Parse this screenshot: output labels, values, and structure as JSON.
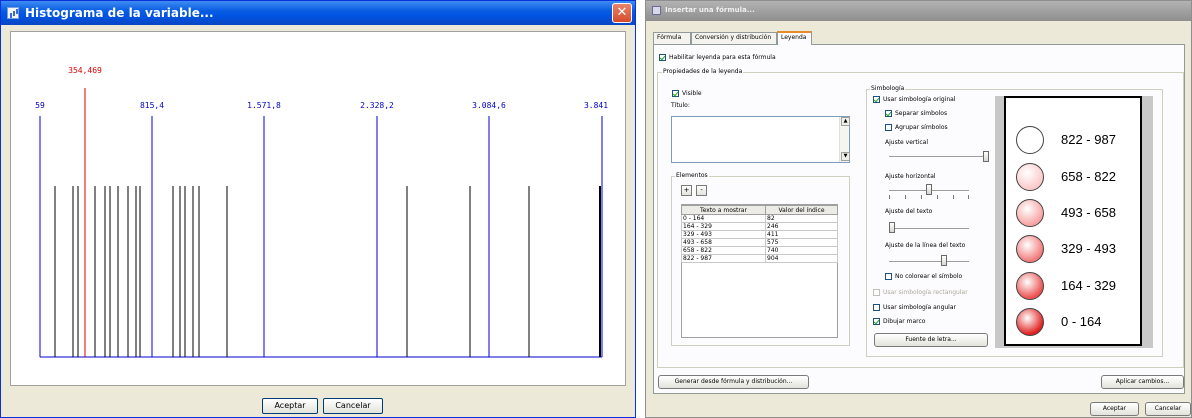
{
  "histogram_window": {
    "title": "Histograma de la variable...",
    "axis_labels": [
      "59",
      "815,4",
      "1.571,8",
      "2.328,2",
      "3.084,6",
      "3.841"
    ],
    "mean_label": "354,469",
    "data_bar_count": 19,
    "ok_button": "Aceptar",
    "cancel_button": "Cancelar",
    "colors": {
      "axis": "#0000d0",
      "mean": "#e00000",
      "bars": "#000000"
    }
  },
  "formula_window": {
    "title": "Insertar una fórmula...",
    "tabs": [
      "Fórmula",
      "Conversión y distribución",
      "Leyenda"
    ],
    "active_tab": "Leyenda",
    "enable_legend_label": "Habilitar leyenda para esta fórmula",
    "enable_legend_checked": true,
    "legend_properties_label": "Propiedades de la leyenda",
    "visible_label": "Visible",
    "visible_checked": true,
    "title_label": "Título:",
    "title_value": "",
    "elements_label": "Elementos",
    "add_symbol": "+",
    "remove_symbol": "-",
    "table_headers": [
      "Texto a mostrar",
      "Valor del índice"
    ],
    "table_rows": [
      [
        "0 - 164",
        "82"
      ],
      [
        "164 - 329",
        "246"
      ],
      [
        "329 - 493",
        "411"
      ],
      [
        "493 - 658",
        "575"
      ],
      [
        "658 - 822",
        "740"
      ],
      [
        "822 - 987",
        "904"
      ]
    ],
    "symbology_label": "Simbología",
    "use_original_symbology": "Usar simbología original",
    "separate_symbols": "Separar símbolos",
    "group_symbols": "Agrupar símbolos",
    "vertical_adjust": "Ajuste vertical",
    "horizontal_adjust": "Ajuste horizontal",
    "text_adjust": "Ajuste del texto",
    "line_text_adjust": "Ajuste de la línea del texto",
    "no_color_symbol": "No colorear el símbolo",
    "rect_symbology": "Usar simbología rectangular",
    "angular_symbology": "Usar simbología angular",
    "draw_frame": "Dibujar marco",
    "font_button": "Fuente de letra...",
    "generate_button": "Generar desde fórmula y distribución...",
    "apply_button": "Aplicar cambios...",
    "ok_button": "Aceptar",
    "cancel_button": "Cancelar",
    "sliders": {
      "vertical": 1.0,
      "horizontal": 0.5,
      "text": 0.0,
      "line_text": 0.7
    },
    "legend_preview": [
      {
        "label": "822 - 987",
        "color": "#ffffff"
      },
      {
        "label": "658 - 822",
        "color": "#fbcaca"
      },
      {
        "label": "493 - 658",
        "color": "#f8a3a3"
      },
      {
        "label": "329 - 493",
        "color": "#f27a7a"
      },
      {
        "label": "164 - 329",
        "color": "#ec5050"
      },
      {
        "label": "0 - 164",
        "color": "#e02020"
      }
    ]
  }
}
